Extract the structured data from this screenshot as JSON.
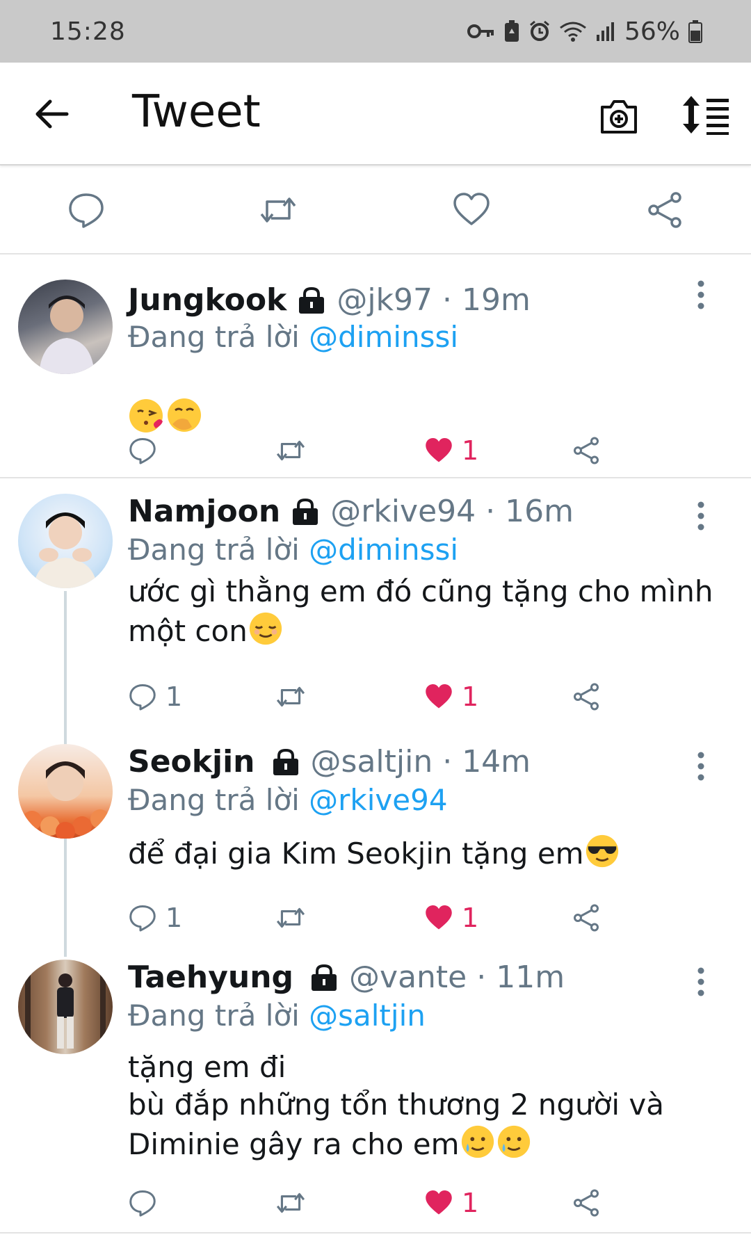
{
  "status_bar": {
    "time": "15:28",
    "battery": "56%",
    "icons": [
      "key-icon",
      "battery-saver-icon",
      "alarm-icon",
      "wifi-icon",
      "signal-icon",
      "battery-icon"
    ]
  },
  "header": {
    "title": "Tweet",
    "icons": [
      "back-arrow-icon",
      "camera-icon",
      "sort-icon"
    ]
  },
  "top_actions": [
    "reply-icon",
    "retweet-icon",
    "like-icon",
    "share-icon"
  ],
  "colors": {
    "link": "#1da1f2",
    "secondary_text": "#657786",
    "like": "#e0245e",
    "divider": "#e3e3e3"
  },
  "tweets": [
    {
      "name": "Jungkook",
      "handle": "@jk97",
      "time": "19m",
      "reply_prefix": "Đang trả lời",
      "reply_to": "@diminssi",
      "body": "",
      "emojis": [
        "kiss-emoji",
        "hand-over-mouth-emoji"
      ],
      "reply_count": "",
      "like_count": "1"
    },
    {
      "name": "Namjoon",
      "handle": "@rkive94",
      "time": "16m",
      "reply_prefix": "Đang trả lời",
      "reply_to": "@diminssi",
      "body": "ước gì thằng em đó cũng tặng cho mình một con",
      "emojis": [
        "relieved-emoji"
      ],
      "reply_count": "1",
      "like_count": "1"
    },
    {
      "name": "Seokjin",
      "handle": "@saltjin",
      "time": "14m",
      "reply_prefix": "Đang trả lời",
      "reply_to": "@rkive94",
      "body": "để đại gia Kim Seokjin tặng em",
      "emojis": [
        "sunglasses-emoji"
      ],
      "reply_count": "1",
      "like_count": "1"
    },
    {
      "name": "Taehyung",
      "handle": "@vante",
      "time": "11m",
      "reply_prefix": "Đang trả lời",
      "reply_to": "@saltjin",
      "body": "tặng em đi\nbù đắp những tổn thương 2 người và Diminie gây ra cho em",
      "emojis": [
        "smiling-tear-emoji",
        "smiling-tear-emoji"
      ],
      "reply_count": "",
      "like_count": "1"
    }
  ]
}
